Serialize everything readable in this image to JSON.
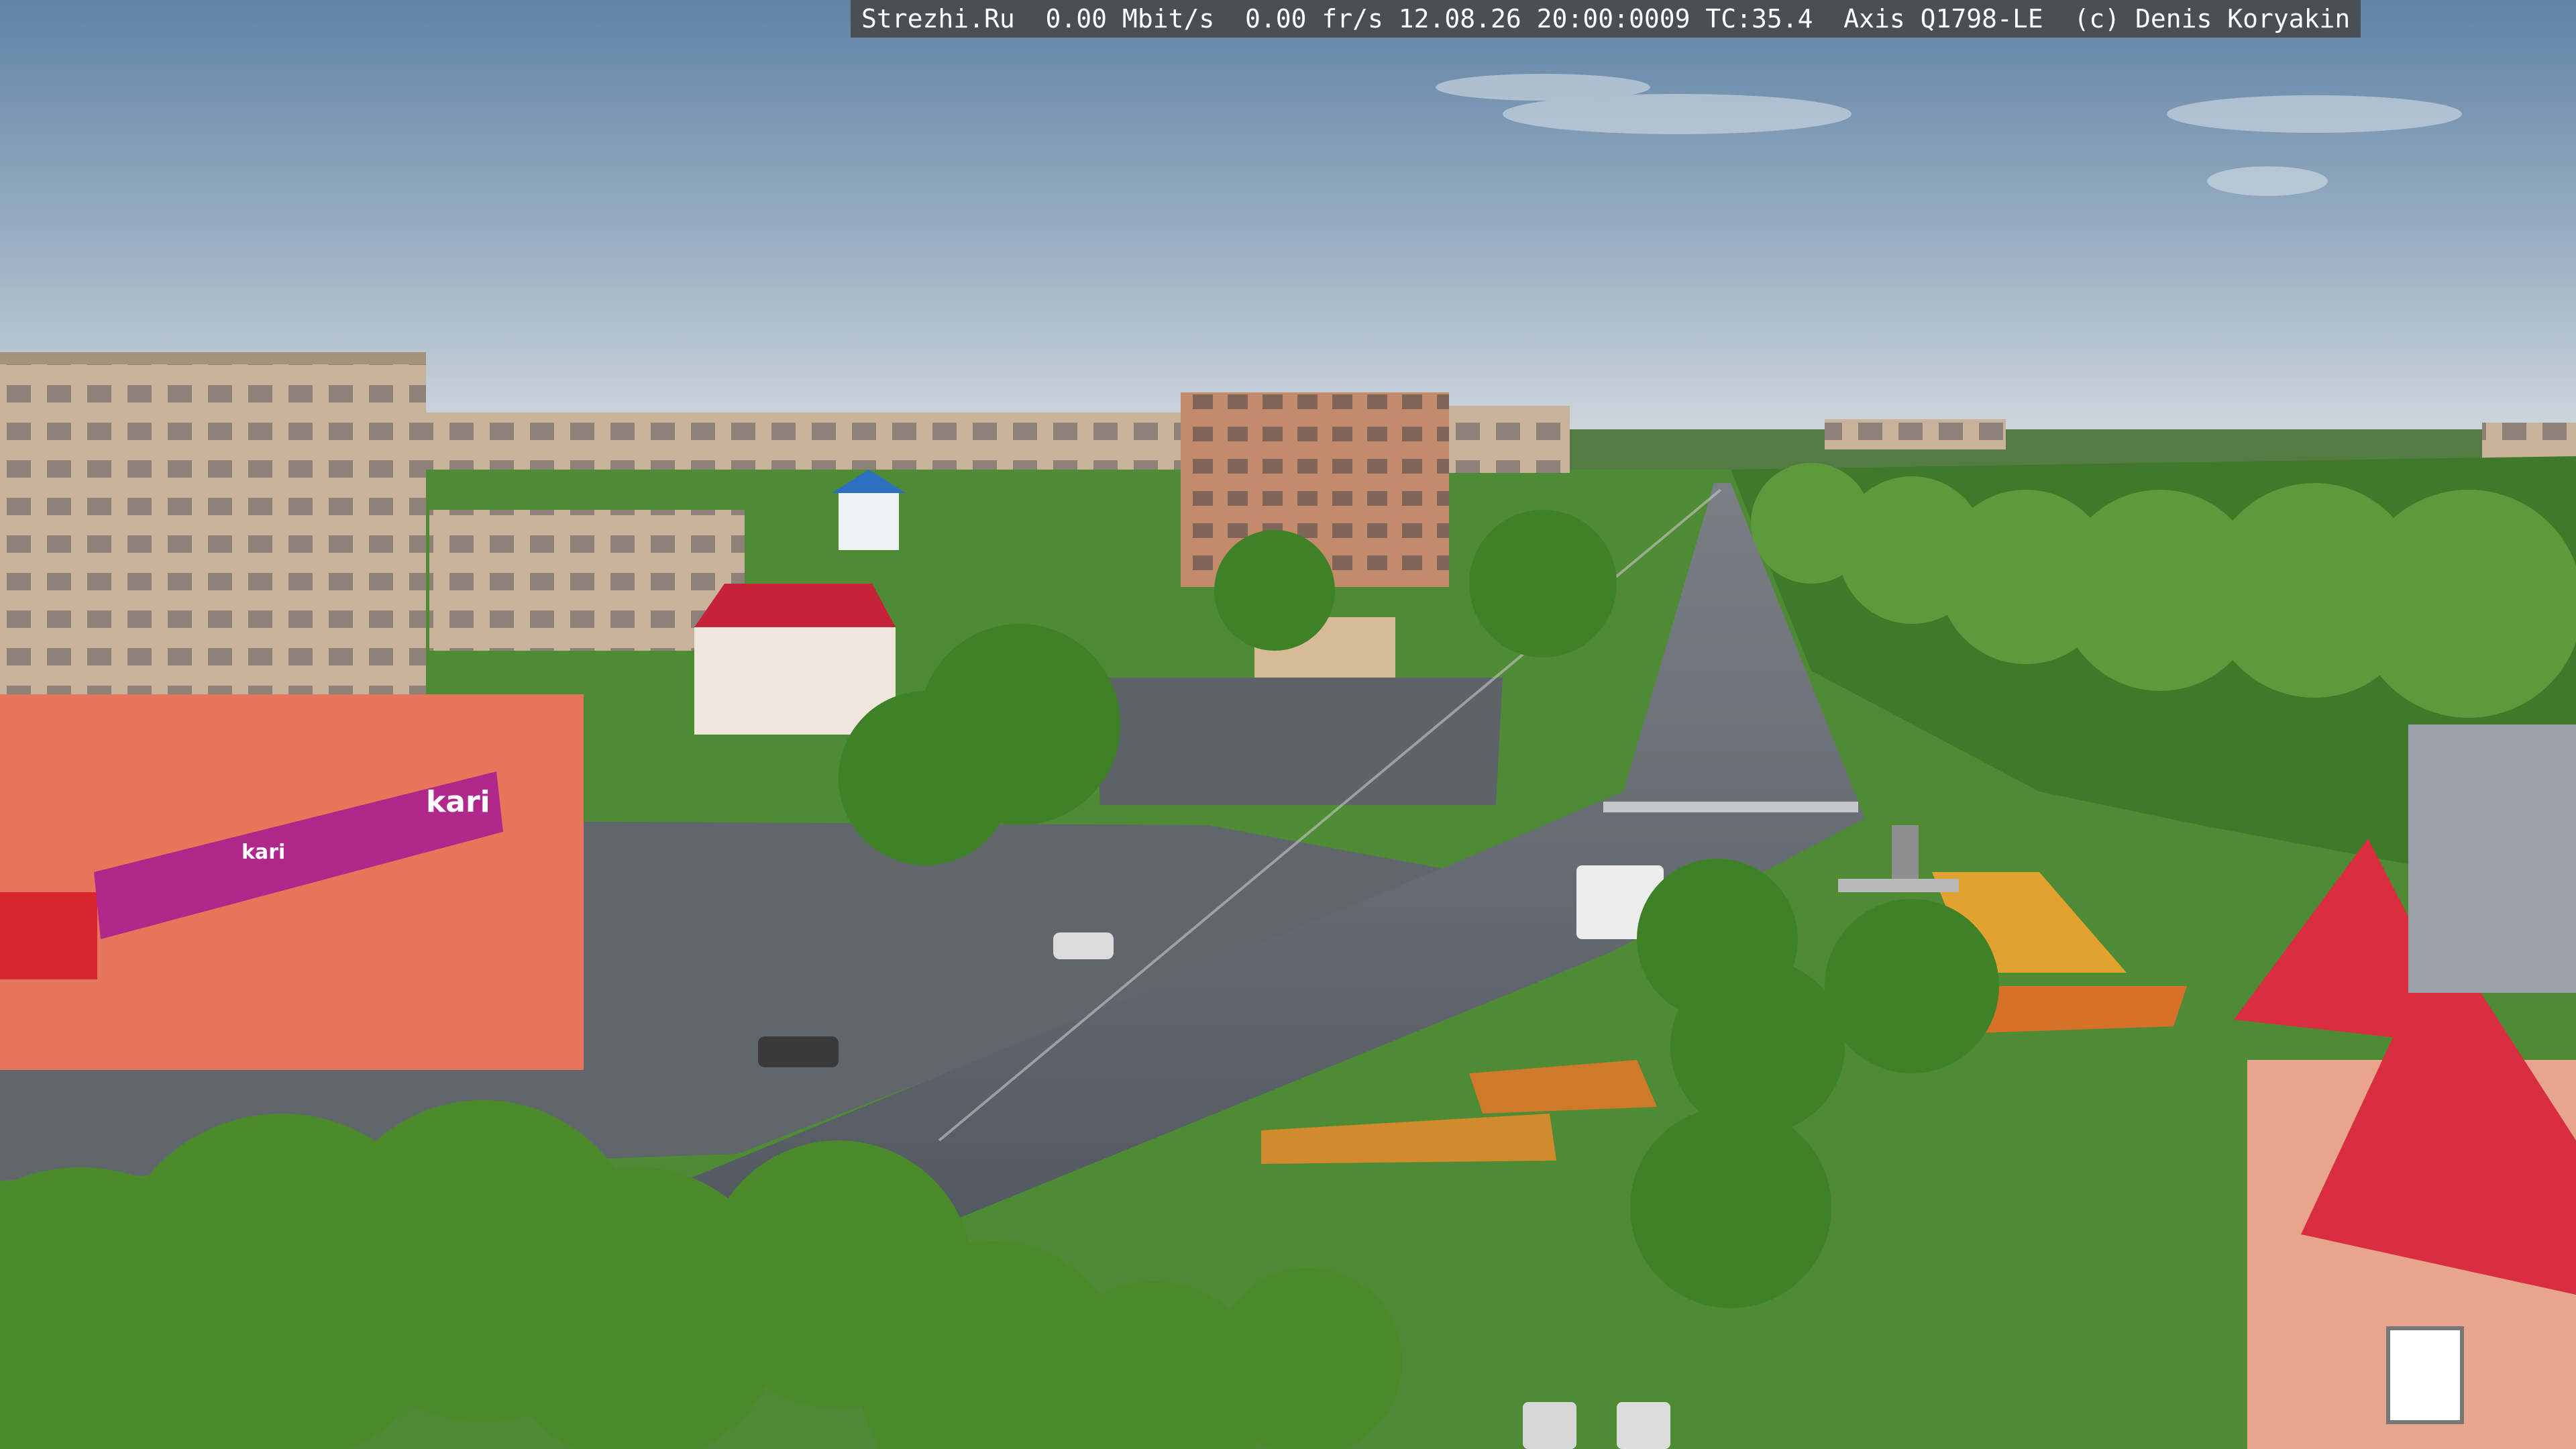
{
  "overlay": {
    "site": "Strezhi.Ru",
    "bitrate": "0.00 Mbit/s",
    "framerate": "0.00 fr/s",
    "datetime": "12.08.26 20:00:0009",
    "temperature": "TC:35.4",
    "camera": "Axis Q1798-LE",
    "copyright": "(c) Denis Koryakin"
  },
  "signs": {
    "store_brand": "kari",
    "store_brand_small": "kari"
  },
  "colors": {
    "sky_top": "#6f90b0",
    "sky_bottom": "#c9d3da",
    "foliage": "#4d8a2f",
    "road": "#5b6168",
    "roof_red": "#d83a48",
    "store_facade": "#e8755a",
    "kari_banner": "#b0288a"
  }
}
